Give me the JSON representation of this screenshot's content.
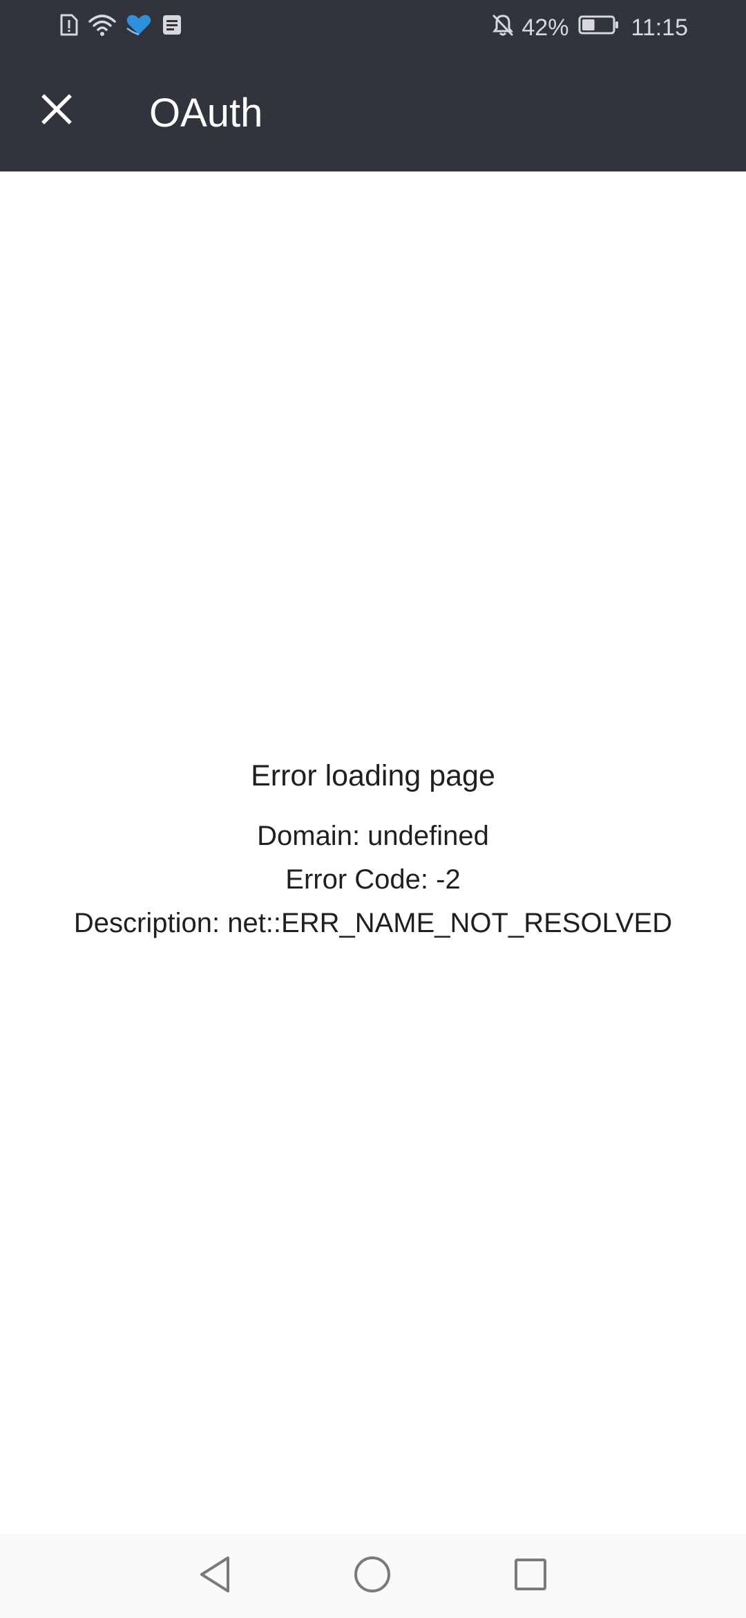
{
  "status_bar": {
    "battery_percent": "42%",
    "time": "11:15",
    "battery_level": 0.42,
    "icons_left": [
      "sim-alert-icon",
      "wifi-icon",
      "heart-app-icon",
      "notes-icon"
    ],
    "icons_right": [
      "bell-off-icon",
      "battery-icon"
    ]
  },
  "app_bar": {
    "title": "OAuth",
    "close_icon": "close-icon",
    "background": "#31343c"
  },
  "error": {
    "title": "Error loading page",
    "domain": "Domain: undefined",
    "code": "Error Code: -2",
    "description": "Description: net::ERR_NAME_NOT_RESOLVED"
  },
  "nav_bar": {
    "back_icon": "back-triangle-icon",
    "home_icon": "home-circle-icon",
    "recent_icon": "recents-square-icon"
  }
}
